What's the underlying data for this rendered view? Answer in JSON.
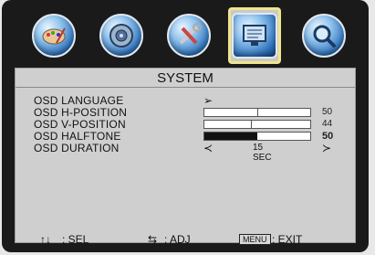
{
  "tabs": [
    {
      "icon": "palette-icon"
    },
    {
      "icon": "speaker-icon"
    },
    {
      "icon": "tools-icon"
    },
    {
      "icon": "monitor-icon",
      "selected": true
    },
    {
      "icon": "magnifier-icon"
    }
  ],
  "panel": {
    "title": "SYSTEM",
    "items": [
      {
        "label": "OSD  LANGUAGE",
        "control": "arrow",
        "arrow": "➢"
      },
      {
        "label": "OSD  H-POSITION",
        "control": "bar",
        "value": "50",
        "level": 0.5
      },
      {
        "label": "OSD  V-POSITION",
        "control": "bar",
        "value": "44",
        "level": 0.44
      },
      {
        "label": "OSD  HALFTONE",
        "control": "bar-dark",
        "value": "50",
        "level": 0.5
      },
      {
        "label": "OSD  DURATION",
        "control": "select",
        "left_arrow": "≺",
        "value": "15  SEC",
        "right_arrow": "≻"
      }
    ]
  },
  "footer": {
    "sel_keys": "↑↓",
    "sel_label": ":  SEL",
    "adj_keys": "⇆",
    "adj_label": ":  ADJ",
    "menu_key": "MENU",
    "exit_label": ":  EXIT"
  },
  "colors": {
    "frame": "#1a1a1a",
    "panel": "#cfcfcf",
    "selected_border": "#f0e58a"
  }
}
